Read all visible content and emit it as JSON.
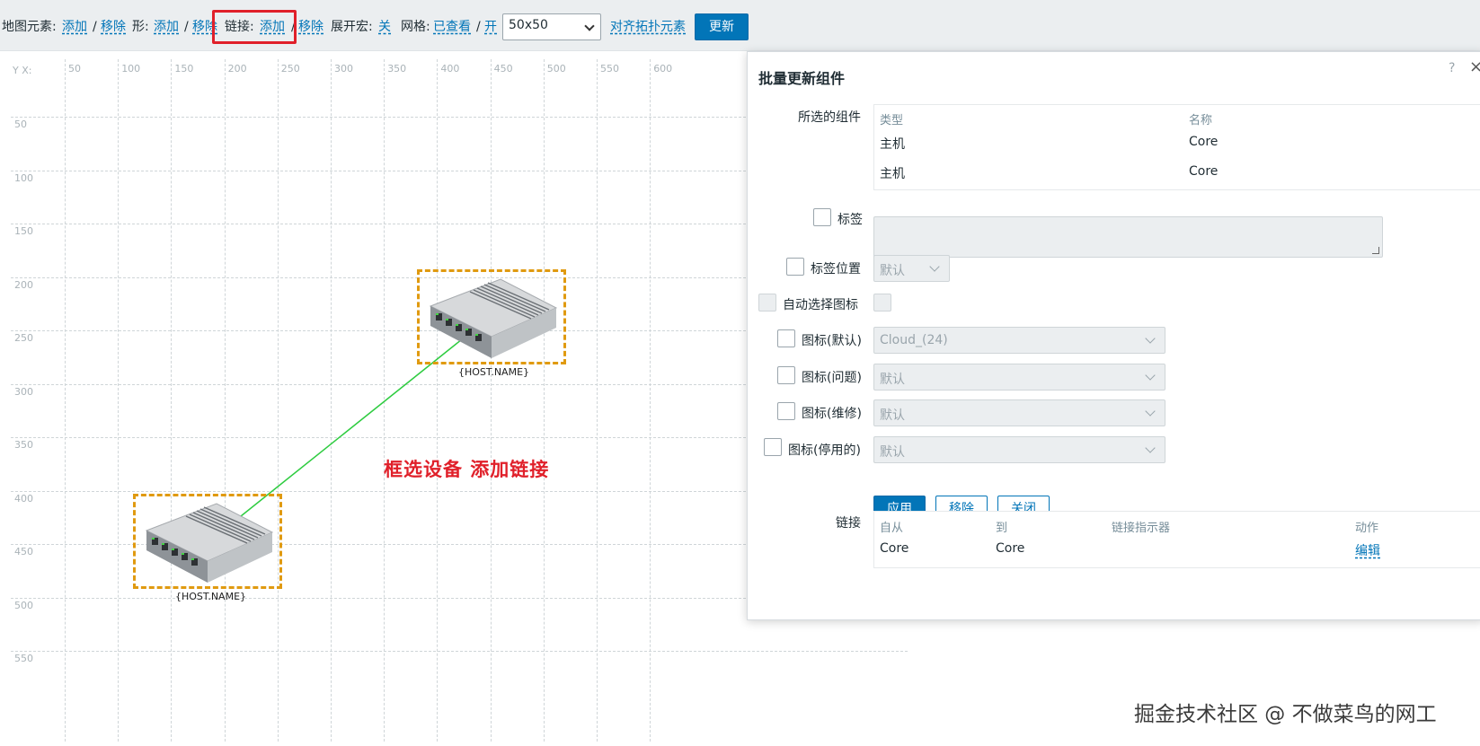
{
  "toolbar": {
    "map_elements_label": "地图元素:",
    "map_elements_add": "添加",
    "map_elements_remove": "移除",
    "shape_label": "形:",
    "shape_add": "添加",
    "shape_remove": "移除",
    "link_label": "链接:",
    "link_add": "添加",
    "link_remove": "移除",
    "expand_macros_label": "展开宏:",
    "expand_macros_value": "关",
    "grid_label": "网格:",
    "grid_shown": "已查看",
    "grid_on": "开",
    "grid_size": "50x50",
    "align_elements": "对齐拓扑元素",
    "update_button": "更新",
    "sep": "/"
  },
  "canvas": {
    "corner_label": "Y X:",
    "x_ticks": [
      "50",
      "100",
      "150",
      "200",
      "250",
      "300",
      "350",
      "400",
      "450",
      "500",
      "550",
      "600"
    ],
    "y_ticks": [
      "50",
      "100",
      "150",
      "200",
      "250",
      "300",
      "350",
      "400",
      "450",
      "500",
      "550"
    ],
    "host1_label": "{HOST.NAME}",
    "host2_label": "{HOST.NAME}",
    "annotation": "框选设备 添加链接",
    "link_color": "#2ecc40",
    "selection_color": "#e09a10"
  },
  "dialog": {
    "title": "批量更新组件",
    "help_icon": "?",
    "close_icon": "×",
    "selected_label": "所选的组件",
    "selected_headers": [
      "类型",
      "名称"
    ],
    "selected_rows": [
      {
        "type": "主机",
        "name": "Core"
      },
      {
        "type": "主机",
        "name": "Core"
      }
    ],
    "label_label": "标签",
    "label_position_label": "标签位置",
    "label_position_value": "默认",
    "auto_icon_label": "自动选择图标",
    "icon_default_label": "图标(默认)",
    "icon_default_value": "Cloud_(24)",
    "icon_problem_label": "图标(问题)",
    "icon_problem_value": "默认",
    "icon_maintenance_label": "图标(维修)",
    "icon_maintenance_value": "默认",
    "icon_disabled_label": "图标(停用的)",
    "icon_disabled_value": "默认",
    "apply_button": "应用",
    "remove_button": "移除",
    "close_button": "关闭",
    "links_label": "链接",
    "links_headers": [
      "自从",
      "到",
      "链接指示器",
      "动作"
    ],
    "links_rows": [
      {
        "from": "Core",
        "to": "Core",
        "indicator": "",
        "action": "编辑"
      }
    ]
  },
  "watermark": "掘金技术社区 @ 不做菜鸟的网工",
  "colors": {
    "accent": "#0275b8",
    "highlight_red": "#e0202a"
  }
}
